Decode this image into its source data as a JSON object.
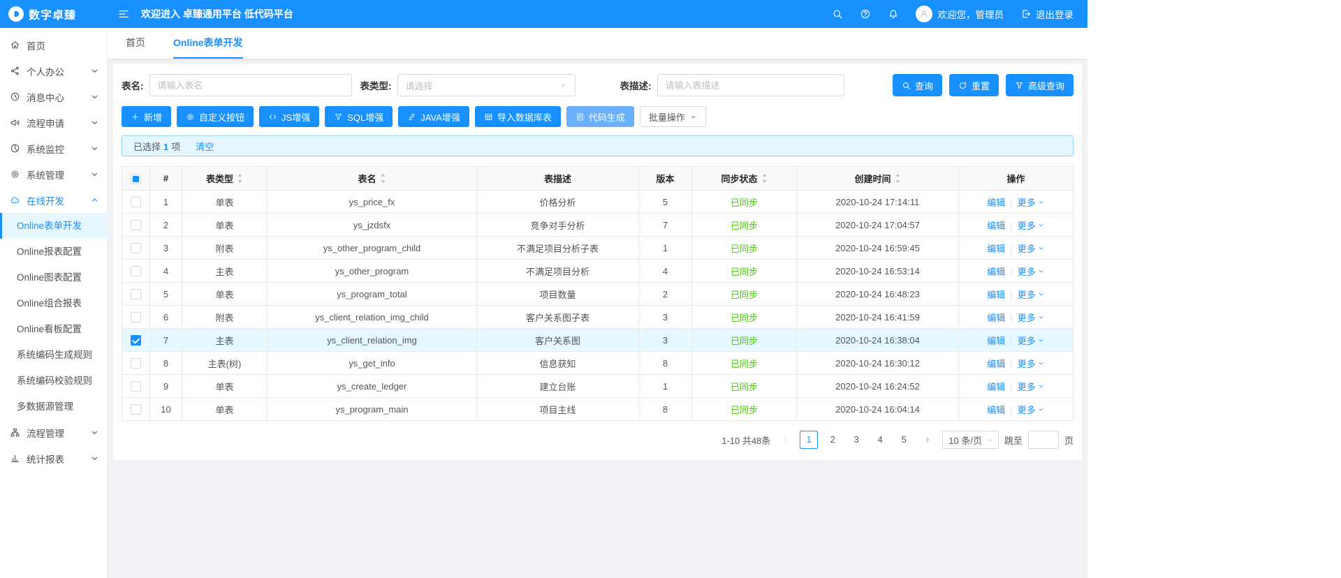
{
  "header": {
    "logo_text": "数字卓臻",
    "welcome_text": "欢迎进入 卓臻通用平台 低代码平台",
    "user_greeting": "欢迎您，管理员",
    "logout_label": "退出登录"
  },
  "sidebar": {
    "items": [
      {
        "label": "首页",
        "icon": "home"
      },
      {
        "label": "个人办公",
        "icon": "share",
        "chevron": "down"
      },
      {
        "label": "消息中心",
        "icon": "clock",
        "chevron": "down"
      },
      {
        "label": "流程申请",
        "icon": "horn",
        "chevron": "down"
      },
      {
        "label": "系统监控",
        "icon": "monitor",
        "chevron": "down"
      },
      {
        "label": "系统管理",
        "icon": "gear",
        "chevron": "down"
      },
      {
        "label": "在线开发",
        "icon": "cloud",
        "chevron": "up",
        "expanded": true,
        "children": [
          {
            "label": "Online表单开发",
            "active": true
          },
          {
            "label": "Online报表配置"
          },
          {
            "label": "Online图表配置"
          },
          {
            "label": "Online组合报表"
          },
          {
            "label": "Online看板配置"
          },
          {
            "label": "系统编码生成规则"
          },
          {
            "label": "系统编码校验规则"
          },
          {
            "label": "多数据源管理"
          }
        ]
      },
      {
        "label": "流程管理",
        "icon": "apartment",
        "chevron": "down"
      },
      {
        "label": "统计报表",
        "icon": "barchart",
        "chevron": "down"
      }
    ]
  },
  "tabs": [
    {
      "label": "首页",
      "active": false
    },
    {
      "label": "Online表单开发",
      "active": true
    }
  ],
  "query": {
    "fields": [
      {
        "label": "表名:",
        "placeholder": "请输入表名",
        "type": "input"
      },
      {
        "label": "表类型:",
        "placeholder": "请选择",
        "type": "select"
      },
      {
        "label": "表描述:",
        "placeholder": "请输入表描述",
        "type": "input"
      }
    ],
    "buttons": [
      {
        "label": "查询",
        "icon": "search"
      },
      {
        "label": "重置",
        "icon": "reload"
      },
      {
        "label": "高级查询",
        "icon": "filter"
      }
    ]
  },
  "toolbar": {
    "buttons": [
      {
        "label": "新增",
        "icon": "plus",
        "style": "primary"
      },
      {
        "label": "自定义按钮",
        "icon": "gear",
        "style": "primary"
      },
      {
        "label": "JS增强",
        "icon": "code",
        "style": "primary"
      },
      {
        "label": "SQL增强",
        "icon": "filter",
        "style": "primary"
      },
      {
        "label": "JAVA增强",
        "icon": "link",
        "style": "primary"
      },
      {
        "label": "导入数据库表",
        "icon": "tableic",
        "style": "primary"
      },
      {
        "label": "代码生成",
        "icon": "filecode",
        "style": "light"
      },
      {
        "label": "批量操作",
        "icon": null,
        "style": "default",
        "caret": true
      }
    ]
  },
  "selection": {
    "prefix": "已选择",
    "count": "1",
    "suffix": "项",
    "clear_label": "清空"
  },
  "table": {
    "columns": [
      {
        "label": "#",
        "sortable": false
      },
      {
        "label": "表类型",
        "sortable": true
      },
      {
        "label": "表名",
        "sortable": true
      },
      {
        "label": "表描述",
        "sortable": false
      },
      {
        "label": "版本",
        "sortable": false
      },
      {
        "label": "同步状态",
        "sortable": true
      },
      {
        "label": "创建时间",
        "sortable": true
      },
      {
        "label": "操作",
        "sortable": false
      }
    ],
    "row_actions": {
      "edit": "编辑",
      "more": "更多"
    },
    "rows": [
      {
        "num": "1",
        "type": "单表",
        "name": "ys_price_fx",
        "desc": "价格分析",
        "version": "5",
        "sync": "已同步",
        "created": "2020-10-24 17:14:11",
        "selected": false
      },
      {
        "num": "2",
        "type": "单表",
        "name": "ys_jzdsfx",
        "desc": "竞争对手分析",
        "version": "7",
        "sync": "已同步",
        "created": "2020-10-24 17:04:57",
        "selected": false
      },
      {
        "num": "3",
        "type": "附表",
        "name": "ys_other_program_child",
        "desc": "不满足项目分析子表",
        "version": "1",
        "sync": "已同步",
        "created": "2020-10-24 16:59:45",
        "selected": false
      },
      {
        "num": "4",
        "type": "主表",
        "name": "ys_other_program",
        "desc": "不满足项目分析",
        "version": "4",
        "sync": "已同步",
        "created": "2020-10-24 16:53:14",
        "selected": false
      },
      {
        "num": "5",
        "type": "单表",
        "name": "ys_program_total",
        "desc": "项目数量",
        "version": "2",
        "sync": "已同步",
        "created": "2020-10-24 16:48:23",
        "selected": false
      },
      {
        "num": "6",
        "type": "附表",
        "name": "ys_client_relation_img_child",
        "desc": "客户关系图子表",
        "version": "3",
        "sync": "已同步",
        "created": "2020-10-24 16:41:59",
        "selected": false
      },
      {
        "num": "7",
        "type": "主表",
        "name": "ys_client_relation_img",
        "desc": "客户关系图",
        "version": "3",
        "sync": "已同步",
        "created": "2020-10-24 16:38:04",
        "selected": true
      },
      {
        "num": "8",
        "type": "主表(树)",
        "name": "ys_get_info",
        "desc": "信息获知",
        "version": "8",
        "sync": "已同步",
        "created": "2020-10-24 16:30:12",
        "selected": false
      },
      {
        "num": "9",
        "type": "单表",
        "name": "ys_create_ledger",
        "desc": "建立台账",
        "version": "1",
        "sync": "已同步",
        "created": "2020-10-24 16:24:52",
        "selected": false
      },
      {
        "num": "10",
        "type": "单表",
        "name": "ys_program_main",
        "desc": "项目主线",
        "version": "8",
        "sync": "已同步",
        "created": "2020-10-24 16:04:14",
        "selected": false
      }
    ]
  },
  "pagination": {
    "total_text": "1-10 共48条",
    "pages": [
      "1",
      "2",
      "3",
      "4",
      "5"
    ],
    "active_page": "1",
    "page_size_label": "10 条/页",
    "jump_prefix": "跳至",
    "jump_suffix": "页"
  },
  "colors": {
    "primary": "#1890ff",
    "success": "#52c41a",
    "light_primary_button": "#69b1ff",
    "selected_row_bg": "#e6f7ff"
  }
}
